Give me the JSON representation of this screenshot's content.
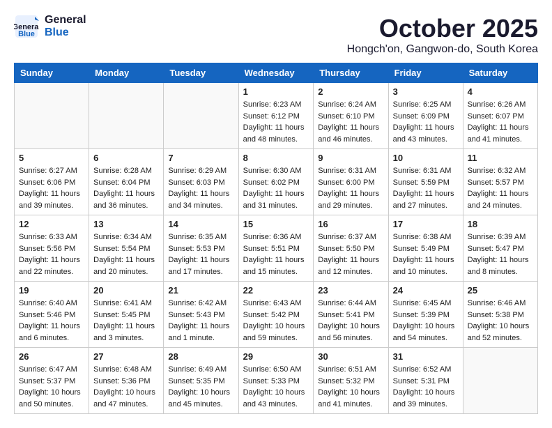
{
  "header": {
    "logo_general": "General",
    "logo_blue": "Blue",
    "month": "October 2025",
    "location": "Hongch'on, Gangwon-do, South Korea"
  },
  "weekdays": [
    "Sunday",
    "Monday",
    "Tuesday",
    "Wednesday",
    "Thursday",
    "Friday",
    "Saturday"
  ],
  "weeks": [
    [
      {
        "day": "",
        "info": ""
      },
      {
        "day": "",
        "info": ""
      },
      {
        "day": "",
        "info": ""
      },
      {
        "day": "1",
        "info": "Sunrise: 6:23 AM\nSunset: 6:12 PM\nDaylight: 11 hours\nand 48 minutes."
      },
      {
        "day": "2",
        "info": "Sunrise: 6:24 AM\nSunset: 6:10 PM\nDaylight: 11 hours\nand 46 minutes."
      },
      {
        "day": "3",
        "info": "Sunrise: 6:25 AM\nSunset: 6:09 PM\nDaylight: 11 hours\nand 43 minutes."
      },
      {
        "day": "4",
        "info": "Sunrise: 6:26 AM\nSunset: 6:07 PM\nDaylight: 11 hours\nand 41 minutes."
      }
    ],
    [
      {
        "day": "5",
        "info": "Sunrise: 6:27 AM\nSunset: 6:06 PM\nDaylight: 11 hours\nand 39 minutes."
      },
      {
        "day": "6",
        "info": "Sunrise: 6:28 AM\nSunset: 6:04 PM\nDaylight: 11 hours\nand 36 minutes."
      },
      {
        "day": "7",
        "info": "Sunrise: 6:29 AM\nSunset: 6:03 PM\nDaylight: 11 hours\nand 34 minutes."
      },
      {
        "day": "8",
        "info": "Sunrise: 6:30 AM\nSunset: 6:02 PM\nDaylight: 11 hours\nand 31 minutes."
      },
      {
        "day": "9",
        "info": "Sunrise: 6:31 AM\nSunset: 6:00 PM\nDaylight: 11 hours\nand 29 minutes."
      },
      {
        "day": "10",
        "info": "Sunrise: 6:31 AM\nSunset: 5:59 PM\nDaylight: 11 hours\nand 27 minutes."
      },
      {
        "day": "11",
        "info": "Sunrise: 6:32 AM\nSunset: 5:57 PM\nDaylight: 11 hours\nand 24 minutes."
      }
    ],
    [
      {
        "day": "12",
        "info": "Sunrise: 6:33 AM\nSunset: 5:56 PM\nDaylight: 11 hours\nand 22 minutes."
      },
      {
        "day": "13",
        "info": "Sunrise: 6:34 AM\nSunset: 5:54 PM\nDaylight: 11 hours\nand 20 minutes."
      },
      {
        "day": "14",
        "info": "Sunrise: 6:35 AM\nSunset: 5:53 PM\nDaylight: 11 hours\nand 17 minutes."
      },
      {
        "day": "15",
        "info": "Sunrise: 6:36 AM\nSunset: 5:51 PM\nDaylight: 11 hours\nand 15 minutes."
      },
      {
        "day": "16",
        "info": "Sunrise: 6:37 AM\nSunset: 5:50 PM\nDaylight: 11 hours\nand 12 minutes."
      },
      {
        "day": "17",
        "info": "Sunrise: 6:38 AM\nSunset: 5:49 PM\nDaylight: 11 hours\nand 10 minutes."
      },
      {
        "day": "18",
        "info": "Sunrise: 6:39 AM\nSunset: 5:47 PM\nDaylight: 11 hours\nand 8 minutes."
      }
    ],
    [
      {
        "day": "19",
        "info": "Sunrise: 6:40 AM\nSunset: 5:46 PM\nDaylight: 11 hours\nand 6 minutes."
      },
      {
        "day": "20",
        "info": "Sunrise: 6:41 AM\nSunset: 5:45 PM\nDaylight: 11 hours\nand 3 minutes."
      },
      {
        "day": "21",
        "info": "Sunrise: 6:42 AM\nSunset: 5:43 PM\nDaylight: 11 hours\nand 1 minute."
      },
      {
        "day": "22",
        "info": "Sunrise: 6:43 AM\nSunset: 5:42 PM\nDaylight: 10 hours\nand 59 minutes."
      },
      {
        "day": "23",
        "info": "Sunrise: 6:44 AM\nSunset: 5:41 PM\nDaylight: 10 hours\nand 56 minutes."
      },
      {
        "day": "24",
        "info": "Sunrise: 6:45 AM\nSunset: 5:39 PM\nDaylight: 10 hours\nand 54 minutes."
      },
      {
        "day": "25",
        "info": "Sunrise: 6:46 AM\nSunset: 5:38 PM\nDaylight: 10 hours\nand 52 minutes."
      }
    ],
    [
      {
        "day": "26",
        "info": "Sunrise: 6:47 AM\nSunset: 5:37 PM\nDaylight: 10 hours\nand 50 minutes."
      },
      {
        "day": "27",
        "info": "Sunrise: 6:48 AM\nSunset: 5:36 PM\nDaylight: 10 hours\nand 47 minutes."
      },
      {
        "day": "28",
        "info": "Sunrise: 6:49 AM\nSunset: 5:35 PM\nDaylight: 10 hours\nand 45 minutes."
      },
      {
        "day": "29",
        "info": "Sunrise: 6:50 AM\nSunset: 5:33 PM\nDaylight: 10 hours\nand 43 minutes."
      },
      {
        "day": "30",
        "info": "Sunrise: 6:51 AM\nSunset: 5:32 PM\nDaylight: 10 hours\nand 41 minutes."
      },
      {
        "day": "31",
        "info": "Sunrise: 6:52 AM\nSunset: 5:31 PM\nDaylight: 10 hours\nand 39 minutes."
      },
      {
        "day": "",
        "info": ""
      }
    ]
  ]
}
